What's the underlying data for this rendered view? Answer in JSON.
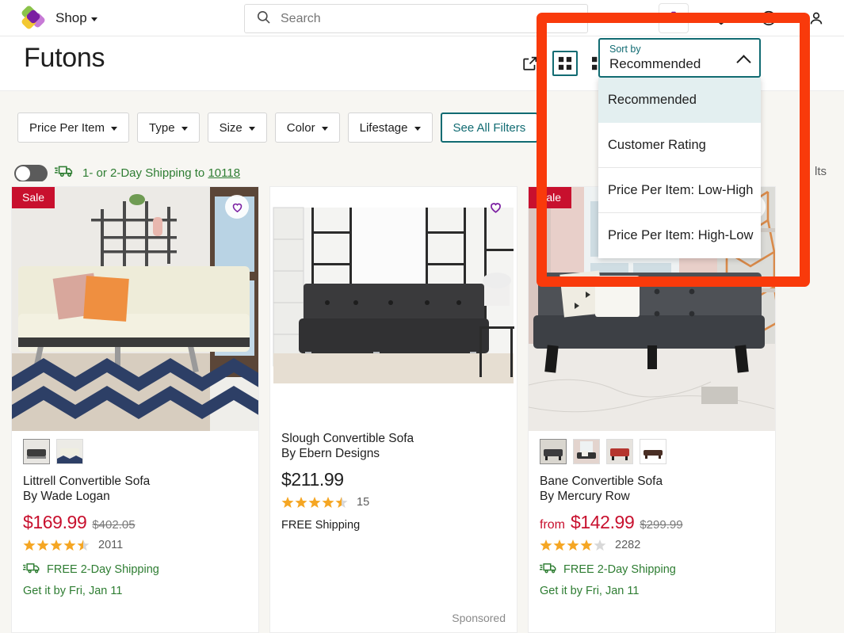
{
  "topnav": {
    "logo_icon": "wayfair-flower-logo",
    "shop_label": "Shop",
    "search": {
      "placeholder": "Search",
      "value": "",
      "icon": "search-icon"
    },
    "icons": [
      {
        "name": "cart-icon",
        "label": "Cart"
      },
      {
        "name": "heart-icon",
        "label": "Favorites"
      },
      {
        "name": "help-icon",
        "label": "Help"
      },
      {
        "name": "account-icon",
        "label": "Account"
      }
    ]
  },
  "page": {
    "title": "Futons",
    "view_icons": [
      {
        "name": "share-icon",
        "selected": false
      },
      {
        "name": "grid-view-icon",
        "selected": true
      },
      {
        "name": "list-view-icon",
        "selected": false
      }
    ],
    "results_text": "lts"
  },
  "filters": {
    "chips": [
      {
        "label": "Price Per Item",
        "caret": true,
        "outline": false
      },
      {
        "label": "Type",
        "caret": true,
        "outline": false
      },
      {
        "label": "Size",
        "caret": true,
        "outline": false
      },
      {
        "label": "Color",
        "caret": true,
        "outline": false
      },
      {
        "label": "Lifestage",
        "caret": true,
        "outline": false
      },
      {
        "label": "See All Filters",
        "caret": false,
        "outline": true
      }
    ],
    "shipping_toggle": {
      "on": false,
      "text_pre": "1- or 2-Day Shipping",
      "text_to": "to",
      "zip": "10118",
      "icon": "fast-shipping-truck-icon"
    }
  },
  "sort": {
    "label": "Sort by",
    "value": "Recommended",
    "chevron_icon": "chevron-up-icon",
    "expanded": true,
    "options": [
      {
        "label": "Recommended",
        "selected": true
      },
      {
        "label": "Customer Rating",
        "selected": false
      },
      {
        "label": "Price Per Item: Low-High",
        "selected": false
      },
      {
        "label": "Price Per Item: High-Low",
        "selected": false
      }
    ]
  },
  "annotation": {
    "color": "#f93a0b",
    "shape": "rounded-rectangle-highlight"
  },
  "products": [
    {
      "badge": "Sale",
      "favorite_icon": "heart-outline-icon",
      "favorite_has_circle": true,
      "thumbnails": 2,
      "name": "Littrell Convertible Sofa",
      "brand": "By Wade Logan",
      "from_label": "",
      "price": "$169.99",
      "price_color": "#c8102e",
      "strike_price": "$402.05",
      "rating": 4.5,
      "reviews": "2011",
      "shipping": "FREE 2-Day Shipping",
      "shipping_green": true,
      "shipping_icon": "fast-shipping-truck-icon",
      "delivery": "Get it by Fri, Jan 11",
      "sponsored": ""
    },
    {
      "badge": "",
      "favorite_icon": "heart-outline-icon",
      "favorite_has_circle": false,
      "thumbnails": 0,
      "name": "Slough Convertible Sofa",
      "brand": "By Ebern Designs",
      "from_label": "",
      "price": "$211.99",
      "price_color": "#1e1e1e",
      "strike_price": "",
      "rating": 4.5,
      "reviews": "15",
      "shipping": "FREE Shipping",
      "shipping_green": false,
      "shipping_icon": "",
      "delivery": "",
      "sponsored": "Sponsored"
    },
    {
      "badge": "Sale",
      "favorite_icon": "heart-outline-icon",
      "favorite_has_circle": true,
      "thumbnails": 4,
      "name": "Bane Convertible Sofa",
      "brand": "By Mercury Row",
      "from_label": "from",
      "price": "$142.99",
      "price_color": "#c8102e",
      "strike_price": "$299.99",
      "rating": 4.0,
      "reviews": "2282",
      "shipping": "FREE 2-Day Shipping",
      "shipping_green": true,
      "shipping_icon": "fast-shipping-truck-icon",
      "delivery": "Get it by Fri, Jan 11",
      "sponsored": ""
    }
  ]
}
